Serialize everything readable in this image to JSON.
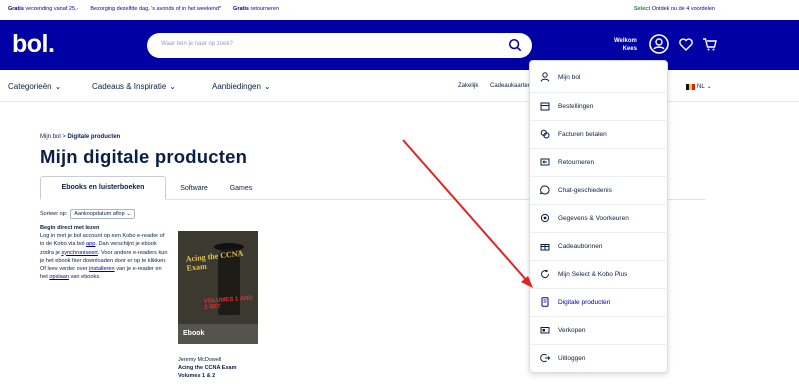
{
  "promo": {
    "items": [
      {
        "bold": "Gratis",
        "text": " verzending vanaf 25,-"
      },
      {
        "bold": "",
        "text": "Bezorging dezelfde dag, 's avonds of in het weekend*"
      },
      {
        "bold": "Gratis",
        "text": " retourneren"
      }
    ],
    "select_bold": "Select",
    "select_text": " Ontdek nu de 4 voordelen"
  },
  "header": {
    "logo": "bol.",
    "search_placeholder": "Waar ben je naar op zoek?",
    "welcome_line1": "Welkom",
    "welcome_line2": "Kees"
  },
  "nav": {
    "items": [
      "Categorieën",
      "Cadeaus & Inspiratie",
      "Aanbiedingen"
    ],
    "right_items": [
      "Zakelijk",
      "Cadeaukaarten"
    ],
    "language": "NL"
  },
  "breadcrumb": {
    "root": "Mijn bol",
    "separator": ">",
    "current": "Digitale producten"
  },
  "page_title": "Mijn digitale producten",
  "tabs": [
    "Ebooks en luisterboeken",
    "Software",
    "Games"
  ],
  "sort": {
    "label": "Sorteer op:",
    "value": "Aankoopdatum aflop"
  },
  "info": {
    "heading": "Begin direct met lezen",
    "text1": "Log in met je bol account op een Kobo e-reader of in de Kobo via bol",
    "link_app": "app",
    "text2": ". Dan verschijnt je ebook zodra je",
    "link_sync": "synchroniseert",
    "text3": ". Voor andere e-readers kun je het ebook hier downloaden door er op te klikken. Of lees verder over",
    "link_install": "installeren",
    "text4": " van je e-reader en het",
    "link_copy": "opslaan",
    "text5": " van ebooks."
  },
  "book": {
    "cover_title": "Acing the CCNA Exam",
    "cover_volumes": "VOLUMES 1 AND 2 SET",
    "badge": "Ebook",
    "author": "Jeremy McDowell",
    "title_line1": "Acing the CCNA Exam",
    "title_line2": "Volumes 1 & 2"
  },
  "dropdown": {
    "items": [
      {
        "label": "Mijn bol",
        "icon": "user-icon"
      },
      {
        "label": "Bestellingen",
        "icon": "box-icon"
      },
      {
        "label": "Facturen betalen",
        "icon": "coins-icon"
      },
      {
        "label": "Retourneren",
        "icon": "return-icon"
      },
      {
        "label": "Chat-geschiedenis",
        "icon": "chat-icon"
      },
      {
        "label": "Gegevens & Voorkeuren",
        "icon": "gear-icon"
      },
      {
        "label": "Cadeaubonnen",
        "icon": "gift-icon"
      },
      {
        "label": "Mijn Select & Kobo Plus",
        "icon": "refresh-icon"
      },
      {
        "label": "Digitale producten",
        "icon": "ebook-icon"
      },
      {
        "label": "Verkopen",
        "icon": "sell-icon"
      },
      {
        "label": "Uitloggen",
        "icon": "logout-icon"
      }
    ]
  },
  "colors": {
    "brand": "#0000a4",
    "arrow": "#e52222",
    "text": "#0b1f44"
  }
}
